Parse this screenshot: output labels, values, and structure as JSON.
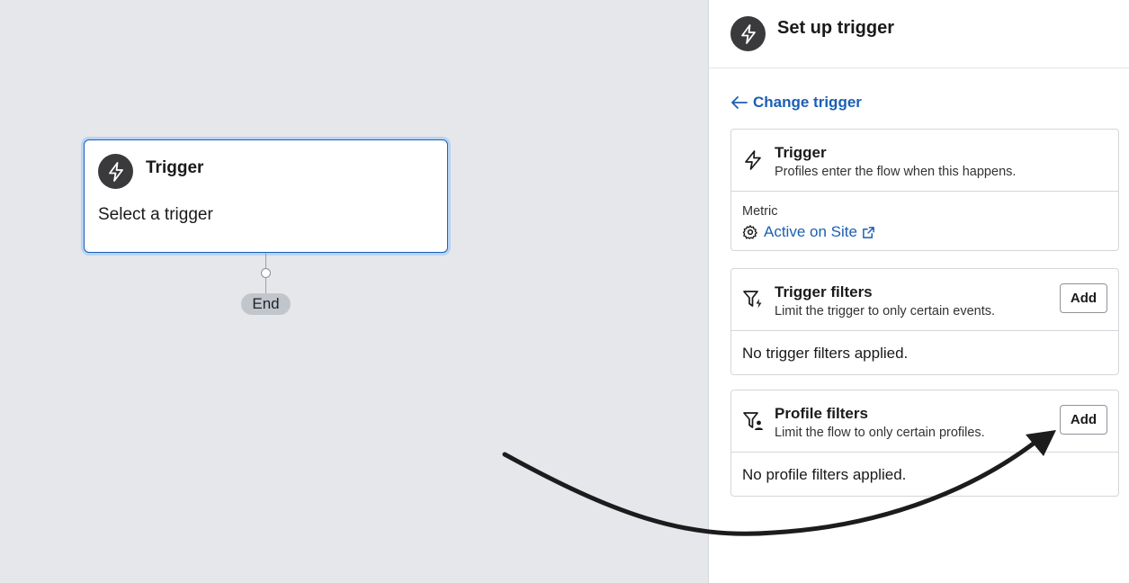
{
  "canvas": {
    "node": {
      "title": "Trigger",
      "subtitle": "Select a trigger",
      "icon": "lightning-icon"
    },
    "end_label": "End"
  },
  "panel": {
    "title": "Set up trigger",
    "back_link": "Change trigger",
    "trigger_card": {
      "title": "Trigger",
      "description": "Profiles enter the flow when this happens.",
      "metric_label": "Metric",
      "metric_value": "Active on Site"
    },
    "trigger_filters": {
      "title": "Trigger filters",
      "description": "Limit the trigger to only certain events.",
      "add_label": "Add",
      "empty_text": "No trigger filters applied."
    },
    "profile_filters": {
      "title": "Profile filters",
      "description": "Limit the flow to only certain profiles.",
      "add_label": "Add",
      "empty_text": "No profile filters applied."
    }
  },
  "colors": {
    "accent": "#1b5fb4",
    "canvas_bg": "#e6e7eb",
    "icon_bg": "#3a3a3c"
  }
}
